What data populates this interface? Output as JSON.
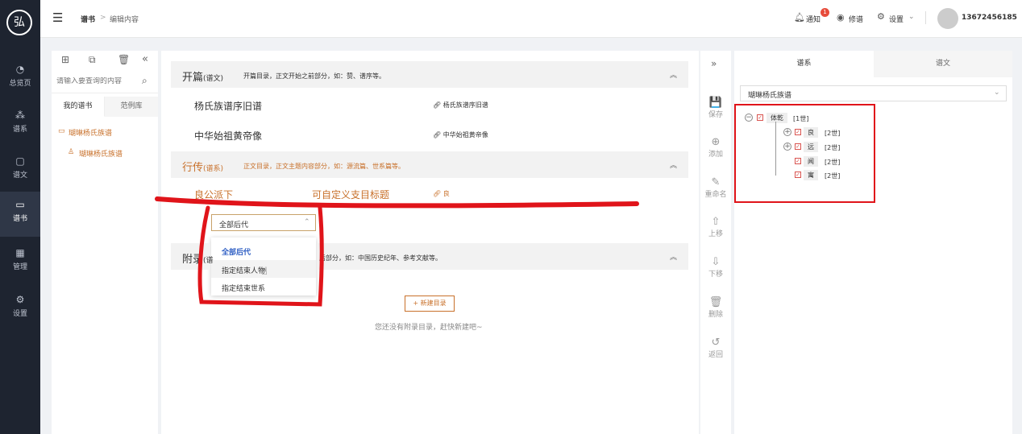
{
  "brand": {
    "logo_text": "弘"
  },
  "nav": [
    {
      "icon": "◔",
      "label": "总览页"
    },
    {
      "icon": "⁂",
      "label": "谱系"
    },
    {
      "icon": "▢",
      "label": "谱文"
    },
    {
      "icon": "▭",
      "label": "谱书"
    },
    {
      "icon": "▦",
      "label": "管理"
    },
    {
      "icon": "⚙",
      "label": "设置"
    }
  ],
  "header": {
    "menu_icon": "☰",
    "breadcrumb_root": "谱书",
    "breadcrumb_sep": ">",
    "breadcrumb_current": "编辑内容",
    "notify_label": "通知",
    "notify_count": "1",
    "preview_label": "修谱",
    "settings_label": "设置",
    "user": "13672456185"
  },
  "library": {
    "search_placeholder": "请输入要查询的内容",
    "tabs": [
      "我的谱书",
      "范例库"
    ],
    "tree_root": "瑚琳杨氏族谱",
    "tree_child": "瑚琳杨氏族谱"
  },
  "content": {
    "sec1": {
      "title": "开篇",
      "tag": "(谱文)",
      "desc": "开篇目录，正文开始之前部分，如：赞、谱序等。"
    },
    "sec1_rows": [
      {
        "title": "杨氏族谱序旧谱",
        "link": "杨氏族谱序旧谱"
      },
      {
        "title": "中华始祖黄帝像",
        "link": "中华始祖黄帝像"
      }
    ],
    "sec2": {
      "title": "行传",
      "tag": "(谱系)",
      "desc": "正文目录，正文主题内容部分，如：源流篇、世系篇等。"
    },
    "sec2_row": {
      "title": "良公派下",
      "subtitle": "可自定义支目标题",
      "link": "良"
    },
    "select_value": "全部后代",
    "dropdown_options": [
      "全部后代",
      "指定结束人物",
      "指定结束世系"
    ],
    "sec3": {
      "title": "附录",
      "tag": "(谱",
      "desc": "后部分，如：中国历史纪年、参考文献等。"
    },
    "new_button": "+ 新建目录",
    "empty_hint": "您还没有附录目录，赶快新建吧~"
  },
  "toolbar": [
    {
      "icon": "💾",
      "label": "保存"
    },
    {
      "icon": "⊕",
      "label": "添加"
    },
    {
      "icon": "✎",
      "label": "重命名"
    },
    {
      "icon": "⇧",
      "label": "上移"
    },
    {
      "icon": "⇩",
      "label": "下移"
    },
    {
      "icon": "🗑",
      "label": "删除"
    },
    {
      "icon": "↺",
      "label": "返回"
    }
  ],
  "right": {
    "tabs": [
      "谱系",
      "谱文"
    ],
    "select": "瑚琳杨氏族谱",
    "tree": [
      {
        "name": "体乾",
        "gen": "[1世]"
      },
      {
        "name": "良",
        "gen": "[2世]"
      },
      {
        "name": "远",
        "gen": "[2世]"
      },
      {
        "name": "闻",
        "gen": "[2世]"
      },
      {
        "name": "寓",
        "gen": "[2世]"
      }
    ]
  },
  "colors": {
    "accent": "#c8702a",
    "nav_bg": "#1e2430",
    "annotation": "#e0141a"
  }
}
